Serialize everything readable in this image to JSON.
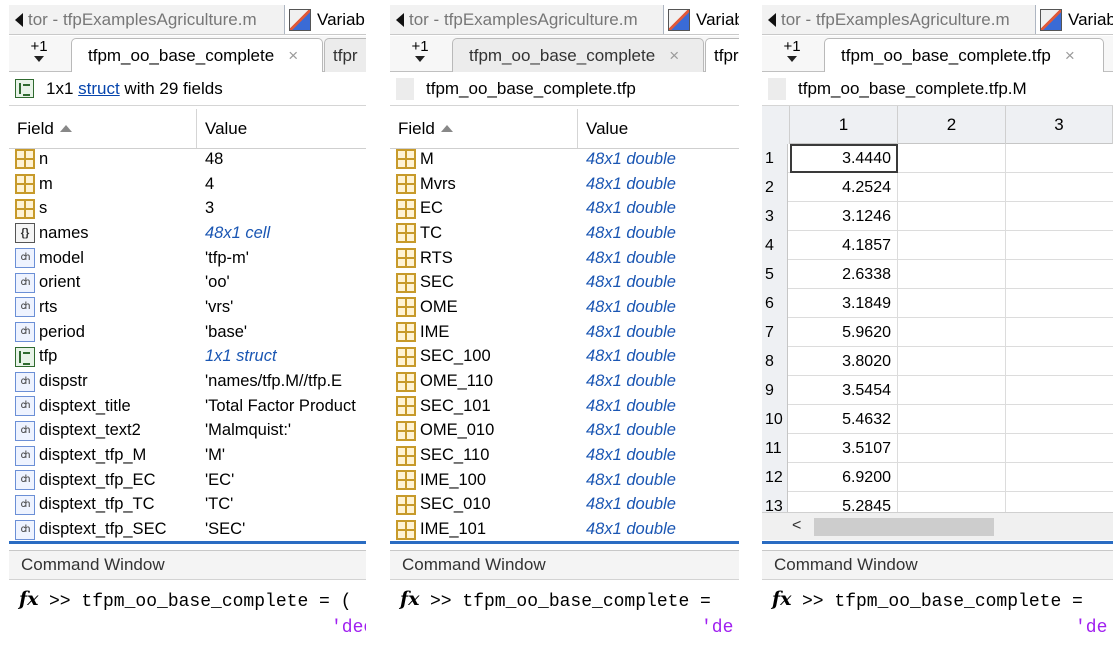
{
  "panels": [
    {
      "window_title": "tor - tfpExamplesAgriculture.m",
      "variables_tab": "Variab",
      "plus_label": "+1",
      "active_tab": "tfpm_oo_base_complete",
      "active_tab_close": "×",
      "next_tab": "tfpr",
      "path_prefix": "1x1 ",
      "path_link": "struct",
      "path_suffix": " with 29 fields",
      "col_field": "Field",
      "col_value": "Value",
      "rows": [
        {
          "icon": "numeric-array-icon",
          "type": "num",
          "name": "n",
          "value": "48"
        },
        {
          "icon": "numeric-array-icon",
          "type": "num",
          "name": "m",
          "value": "4"
        },
        {
          "icon": "numeric-array-icon",
          "type": "num",
          "name": "s",
          "value": "3"
        },
        {
          "icon": "cell-array-icon",
          "type": "cell",
          "name": "names",
          "value": "48x1 cell"
        },
        {
          "icon": "char-array-icon",
          "type": "char",
          "name": "model",
          "value": "'tfp-m'"
        },
        {
          "icon": "char-array-icon",
          "type": "char",
          "name": "orient",
          "value": "'oo'"
        },
        {
          "icon": "char-array-icon",
          "type": "char",
          "name": "rts",
          "value": "'vrs'"
        },
        {
          "icon": "char-array-icon",
          "type": "char",
          "name": "period",
          "value": "'base'"
        },
        {
          "icon": "struct-icon",
          "type": "struct",
          "name": "tfp",
          "value": "1x1 struct"
        },
        {
          "icon": "char-array-icon",
          "type": "char",
          "name": "dispstr",
          "value": "'names/tfp.M//tfp.E"
        },
        {
          "icon": "char-array-icon",
          "type": "char",
          "name": "disptext_title",
          "value": "'Total Factor Product"
        },
        {
          "icon": "char-array-icon",
          "type": "char",
          "name": "disptext_text2",
          "value": "'Malmquist:'"
        },
        {
          "icon": "char-array-icon",
          "type": "char",
          "name": "disptext_tfp_M",
          "value": "'M'"
        },
        {
          "icon": "char-array-icon",
          "type": "char",
          "name": "disptext_tfp_EC",
          "value": "'EC'"
        },
        {
          "icon": "char-array-icon",
          "type": "char",
          "name": "disptext_tfp_TC",
          "value": "'TC'"
        },
        {
          "icon": "char-array-icon",
          "type": "char",
          "name": "disptext_tfp_SEC",
          "value": "'SEC'"
        }
      ],
      "command_window_title": "Command Window",
      "fx": "fx",
      "command": ">> tfpm_oo_base_complete = (",
      "command_string": "'dec"
    },
    {
      "window_title": "tor - tfpExamplesAgriculture.m",
      "variables_tab": "Variab",
      "plus_label": "+1",
      "active_tab": "tfpm_oo_base_complete",
      "active_tab_close": "×",
      "next_tab": "tfpr",
      "path_text": "tfpm_oo_base_complete.tfp",
      "col_field": "Field",
      "col_value": "Value",
      "rows": [
        {
          "name": "M",
          "value": "48x1 double"
        },
        {
          "name": "Mvrs",
          "value": "48x1 double"
        },
        {
          "name": "EC",
          "value": "48x1 double"
        },
        {
          "name": "TC",
          "value": "48x1 double"
        },
        {
          "name": "RTS",
          "value": "48x1 double"
        },
        {
          "name": "SEC",
          "value": "48x1 double"
        },
        {
          "name": "OME",
          "value": "48x1 double"
        },
        {
          "name": "IME",
          "value": "48x1 double"
        },
        {
          "name": "SEC_100",
          "value": "48x1 double"
        },
        {
          "name": "OME_110",
          "value": "48x1 double"
        },
        {
          "name": "SEC_101",
          "value": "48x1 double"
        },
        {
          "name": "OME_010",
          "value": "48x1 double"
        },
        {
          "name": "SEC_110",
          "value": "48x1 double"
        },
        {
          "name": "IME_100",
          "value": "48x1 double"
        },
        {
          "name": "SEC_010",
          "value": "48x1 double"
        },
        {
          "name": "IME_101",
          "value": "48x1 double"
        }
      ],
      "command_window_title": "Command Window",
      "fx": "fx",
      "command": ">> tfpm_oo_base_complete =",
      "command_string": "'de"
    },
    {
      "window_title": "tor - tfpExamplesAgriculture.m",
      "variables_tab": "Variab",
      "plus_label": "+1",
      "active_tab": "tfpm_oo_base_complete.tfp",
      "active_tab_close": "×",
      "path_text": "tfpm_oo_base_complete.tfp.M",
      "columns": [
        "1",
        "2",
        "3"
      ],
      "row_numbers": [
        "1",
        "2",
        "3",
        "4",
        "5",
        "6",
        "7",
        "8",
        "9",
        "10",
        "11",
        "12",
        "13"
      ],
      "values": [
        "3.4440",
        "4.2524",
        "3.1246",
        "4.1857",
        "2.6338",
        "3.1849",
        "5.9620",
        "3.8020",
        "3.5454",
        "5.4632",
        "3.5107",
        "6.9200",
        "5.2845"
      ],
      "scroll_left": "<",
      "command_window_title": "Command Window",
      "fx": "fx",
      "command": ">> tfpm_oo_base_complete =",
      "command_string": "'de"
    }
  ]
}
